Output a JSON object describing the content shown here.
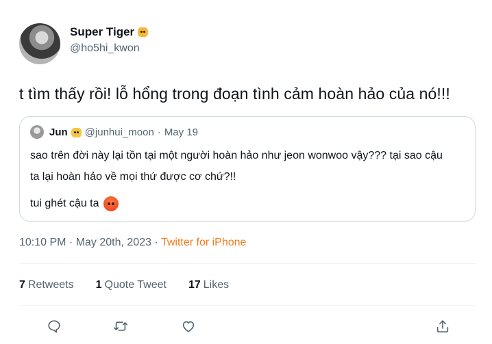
{
  "author": {
    "display_name": "Super Tiger",
    "name_emoji": "tiger-face-emoji",
    "handle": "@ho5hi_kwon"
  },
  "tweet": {
    "text": "t tìm thấy rồi! lỗ hổng trong đoạn tình cảm hoàn hảo của nó!!!"
  },
  "quote": {
    "display_name": "Jun",
    "name_emoji": "cat-face-emoji",
    "handle": "@junhui_moon",
    "separator": "·",
    "date": "May 19",
    "line1": "sao trên đời này lại tồn tại một người hoàn hảo như jeon wonwoo vậy??? tại sao cậu",
    "line2": "ta lại hoàn hảo về mọi thứ được cơ chứ?!!",
    "line3": "tui ghét cậu ta",
    "line3_emoji": "angry-face-emoji"
  },
  "timestamp": {
    "time_date": "10:10 PM · May 20th, 2023 ·",
    "source": "Twitter for iPhone"
  },
  "stats": {
    "retweets_count": "7",
    "retweets_label": "Retweets",
    "quotes_count": "1",
    "quotes_label": "Quote Tweet",
    "likes_count": "17",
    "likes_label": "Likes"
  },
  "actions": [
    "reply-icon",
    "retweet-icon",
    "like-icon",
    "share-icon"
  ],
  "colors": {
    "text": "#0f1419",
    "secondary": "#536471",
    "source_link": "#f07c1c",
    "border": "#cfd9de"
  }
}
